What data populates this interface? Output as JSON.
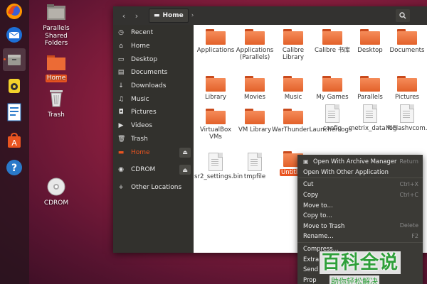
{
  "colors": {
    "accent": "#e95420",
    "sidebar": "#32312d",
    "titlebar": "#333230",
    "menu": "#3b3a36",
    "watermark": "#2f9f3a"
  },
  "dock": {
    "items": [
      {
        "name": "firefox-icon"
      },
      {
        "name": "thunderbird-icon"
      },
      {
        "name": "files-icon"
      },
      {
        "name": "rhythmbox-icon"
      },
      {
        "name": "libreoffice-writer-icon"
      },
      {
        "name": "software-center-icon"
      },
      {
        "name": "help-icon"
      }
    ]
  },
  "desktop": {
    "parallels": "Parallels Shared Folders",
    "home": "Home",
    "trash": "Trash",
    "cdrom": "CDROM"
  },
  "window": {
    "breadcrumb": "Home"
  },
  "sidebar": {
    "items": [
      {
        "label": "Recent",
        "icon": "clock-icon"
      },
      {
        "label": "Home",
        "icon": "home-icon"
      },
      {
        "label": "Desktop",
        "icon": "desktop-icon"
      },
      {
        "label": "Documents",
        "icon": "documents-icon"
      },
      {
        "label": "Downloads",
        "icon": "downloads-icon"
      },
      {
        "label": "Music",
        "icon": "music-icon"
      },
      {
        "label": "Pictures",
        "icon": "camera-icon"
      },
      {
        "label": "Videos",
        "icon": "video-icon"
      },
      {
        "label": "Trash",
        "icon": "trash-icon"
      },
      {
        "label": "Home",
        "icon": "drive-icon"
      },
      {
        "label": "CDROM",
        "icon": "disc-icon"
      },
      {
        "label": "Other Locations",
        "icon": "plus-icon"
      }
    ]
  },
  "files": [
    {
      "label": "Applications",
      "type": "folder"
    },
    {
      "label": "Applications (Parallels)",
      "type": "folder"
    },
    {
      "label": "Calibre Library",
      "type": "folder"
    },
    {
      "label": "Calibre 书库",
      "type": "folder"
    },
    {
      "label": "Desktop",
      "type": "folder"
    },
    {
      "label": "Documents",
      "type": "folder"
    },
    {
      "label": "Library",
      "type": "folder"
    },
    {
      "label": "Movies",
      "type": "folder"
    },
    {
      "label": "Music",
      "type": "folder"
    },
    {
      "label": "My Games",
      "type": "folder"
    },
    {
      "label": "Parallels",
      "type": "folder"
    },
    {
      "label": "Pictures",
      "type": "folder"
    },
    {
      "label": "VirtualBox VMs",
      "type": "folder"
    },
    {
      "label": "VM Library",
      "type": "folder"
    },
    {
      "label": "WarThunderLauncherLogs",
      "type": "folder"
    },
    {
      "label": "config",
      "type": "file"
    },
    {
      "label": "metrix_data.log",
      "type": "file"
    },
    {
      "label": "MiFlashvcom.ini",
      "type": "file"
    },
    {
      "label": "sr2_settings.bin",
      "type": "file"
    },
    {
      "label": "tmpfile",
      "type": "file"
    },
    {
      "label": "Untitled",
      "type": "folder"
    }
  ],
  "context_menu": {
    "items": [
      {
        "label": "Open With Archive Manager",
        "accel": "Return"
      },
      {
        "label": "Open With Other Application",
        "accel": ""
      },
      {
        "label": "Cut",
        "accel": "Ctrl+X"
      },
      {
        "label": "Copy",
        "accel": "Ctrl+C"
      },
      {
        "label": "Move to…",
        "accel": ""
      },
      {
        "label": "Copy to…",
        "accel": ""
      },
      {
        "label": "Move to Trash",
        "accel": "Delete"
      },
      {
        "label": "Rename…",
        "accel": "F2"
      },
      {
        "label": "Compress…",
        "accel": ""
      },
      {
        "label": "Extra",
        "accel": ""
      },
      {
        "label": "Send",
        "accel": ""
      },
      {
        "label": "Prop",
        "accel": ""
      }
    ]
  },
  "watermark": {
    "main": "百科全说",
    "sub": "助你轻松解决"
  }
}
